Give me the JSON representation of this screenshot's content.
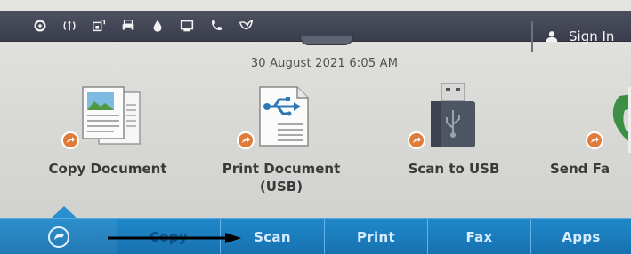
{
  "statusbar": {
    "icons": [
      "settings-icon",
      "wireless-icon",
      "wifi-direct-icon",
      "printer-status-icon",
      "ink-drop-icon",
      "tray-icon",
      "fax-phone-icon",
      "eco-leaf-icon"
    ],
    "signin_label": "Sign In"
  },
  "datetime": "30 August 2021 6:05 AM",
  "apps": [
    {
      "label_line1": "Copy Document",
      "label_line2": ""
    },
    {
      "label_line1": "Print Document",
      "label_line2": "(USB)"
    },
    {
      "label_line1": "Scan to USB",
      "label_line2": ""
    },
    {
      "label_line1": "Send Fa",
      "label_line2": ""
    }
  ],
  "tabs": {
    "home_icon": "home-icon",
    "copy": "Copy",
    "scan": "Scan",
    "print": "Print",
    "fax": "Fax",
    "apps": "Apps"
  },
  "colors": {
    "statusbar": "#3f4250",
    "tabbar": "#1b7fc0",
    "badge": "#e07b3a"
  }
}
